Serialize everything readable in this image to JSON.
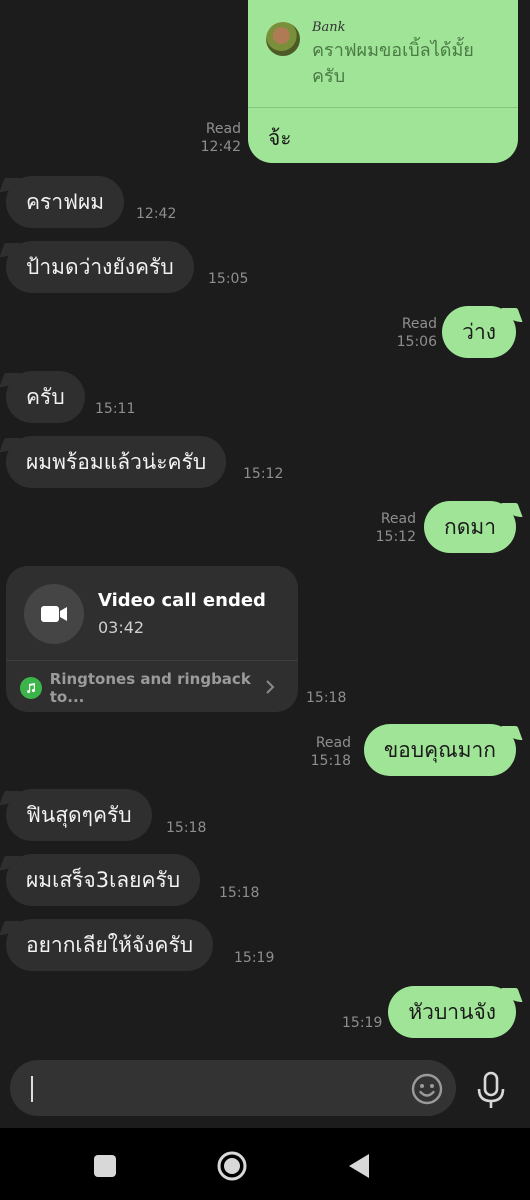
{
  "reply_card": {
    "quoted_name": "Bank",
    "quoted_text": "คราฟผมขอเบิ้ลได้มั้ยครับ",
    "reply_text": "จ้ะ",
    "read": "Read",
    "time": "12:42"
  },
  "messages": [
    {
      "text": "คราฟผม",
      "time": "12:42"
    },
    {
      "text": "ป้ามดว่างยังครับ",
      "time": "15:05"
    },
    {
      "text": "ว่าง",
      "read": "Read",
      "time": "15:06"
    },
    {
      "text": "ครับ",
      "time": "15:11"
    },
    {
      "text": "ผมพร้อมแล้วน่ะครับ",
      "time": "15:12"
    },
    {
      "text": "กดมา",
      "read": "Read",
      "time": "15:12"
    },
    {
      "text": "ขอบคุณมาก",
      "read": "Read",
      "time": "15:18"
    },
    {
      "text": "ฟินสุดๆครับ",
      "time": "15:18"
    },
    {
      "text": "ผมเสร็จ3เลยครับ",
      "time": "15:18"
    },
    {
      "text": "อยากเลียให้จังครับ",
      "time": "15:19"
    },
    {
      "text": "หัวบานจัง",
      "time": "15:19"
    }
  ],
  "call_card": {
    "title": "Video call ended",
    "duration": "03:42",
    "link": "Ringtones and ringback to...",
    "time": "15:18"
  },
  "input": {
    "placeholder": ""
  },
  "colors": {
    "outgoing": "#a0e597",
    "incoming": "#2f2f2f",
    "background": "#1c1c1c"
  },
  "icons": [
    "video-camera-icon",
    "music-note-icon",
    "chevron-right-icon",
    "emoji-icon",
    "microphone-icon",
    "recent-apps-icon",
    "home-icon",
    "back-icon"
  ]
}
